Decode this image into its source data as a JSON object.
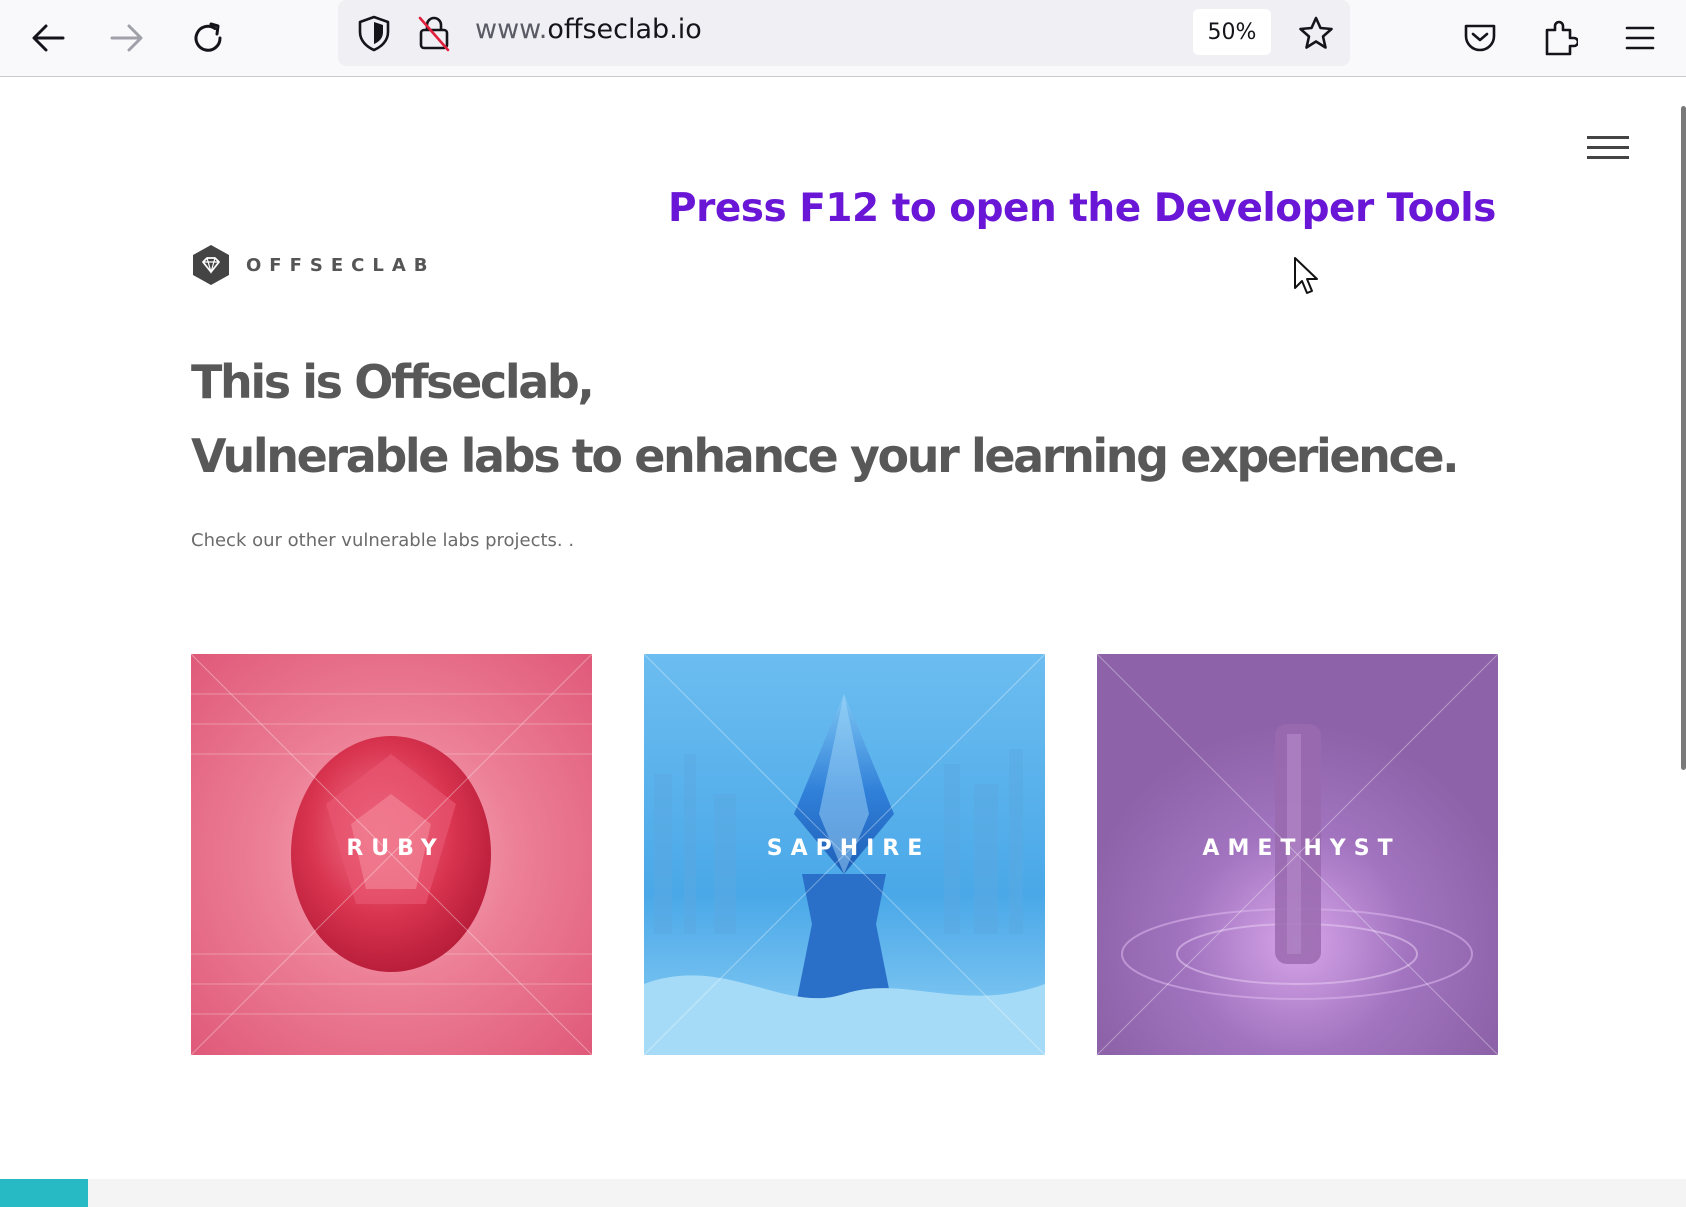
{
  "browser": {
    "url_prefix": "www.",
    "url_domain": "offseclab.io",
    "zoom_level": "50%",
    "buttons": {
      "back": "back-arrow-icon",
      "forward": "forward-arrow-icon",
      "reload": "reload-icon",
      "tracking_protection": "shield-icon",
      "insecure_connection": "lock-slash-icon",
      "bookmark": "star-icon",
      "pocket": "pocket-icon",
      "extensions": "puzzle-icon",
      "menu": "hamburger-menu-icon"
    }
  },
  "page": {
    "menu_icon": "hamburger-menu-icon",
    "banner": "Press F12 to open the Developer Tools",
    "logo": {
      "icon": "diamond-hexagon-icon",
      "text": "OFFSECLAB"
    },
    "hero": {
      "line1": "This is Offseclab,",
      "line2": "Vulnerable labs to enhance your learning experience."
    },
    "subtitle": "Check our other vulnerable labs projects. .",
    "projects": [
      {
        "label": "RUBY",
        "color": "#e05a7a"
      },
      {
        "label": "SAPHIRE",
        "color": "#4aa8e8"
      },
      {
        "label": "AMETHYST",
        "color": "#8d62a8"
      }
    ]
  },
  "colors": {
    "banner": "#6a16d6",
    "heading": "#585858",
    "accent_bar": "#27b9c4"
  }
}
